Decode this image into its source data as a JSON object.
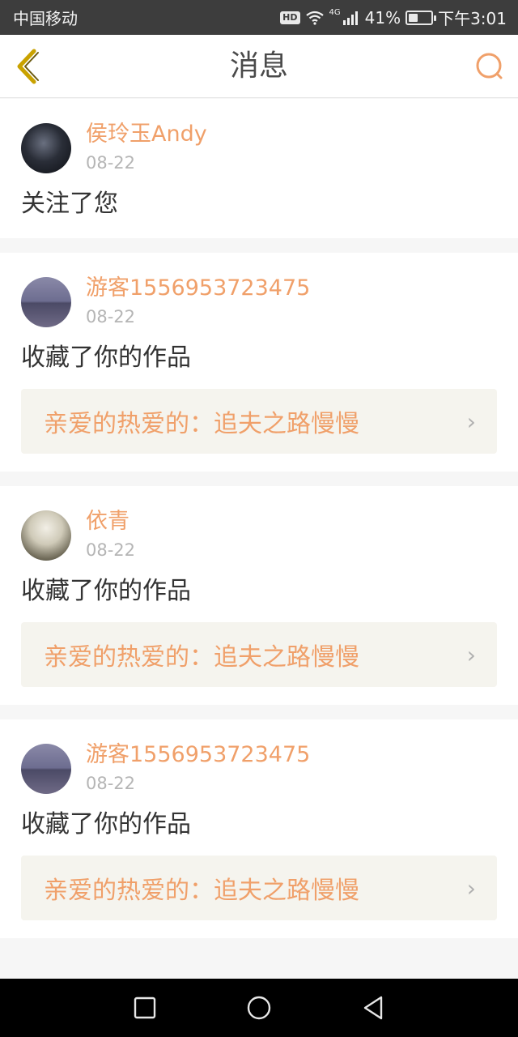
{
  "status_bar": {
    "carrier": "中国移动",
    "hd_label": "HD",
    "network_label": "4G",
    "battery_text": "41%",
    "battery_level": 0.41,
    "time": "下午3:01"
  },
  "header": {
    "title": "消息",
    "back_icon": "chevron-left-icon",
    "search_icon": "search-icon",
    "accent_color": "#f0a06a"
  },
  "messages": [
    {
      "name": "侯玲玉Andy",
      "date": "08-22",
      "action": "关注了您"
    },
    {
      "name": "游客1556953723475",
      "date": "08-22",
      "action": "收藏了你的作品",
      "work_title": "亲爱的热爱的：追夫之路慢慢"
    },
    {
      "name": "依青",
      "date": "08-22",
      "action": "收藏了你的作品",
      "work_title": "亲爱的热爱的：追夫之路慢慢"
    },
    {
      "name": "游客1556953723475",
      "date": "08-22",
      "action": "收藏了你的作品",
      "work_title": "亲爱的热爱的：追夫之路慢慢"
    }
  ],
  "system_nav": {
    "recent_icon": "square-icon",
    "home_icon": "circle-icon",
    "back_icon": "triangle-back-icon"
  }
}
